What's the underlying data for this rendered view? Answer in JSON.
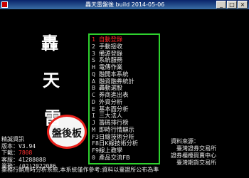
{
  "window": {
    "title": "轟天雷盤後 build 2014-05-06"
  },
  "brand": {
    "chars": [
      "轟",
      "天",
      "雷"
    ]
  },
  "badge": {
    "label": "盤後板"
  },
  "info": {
    "title": "精誠資訊",
    "version": "版本：V3.94",
    "download": "下載：",
    "download_count": "7808",
    "phone": "客服：41288088",
    "service_label": "業務：(02)2022086"
  },
  "menu": {
    "items": [
      {
        "key": "1",
        "label": "自動登錄",
        "active": true
      },
      {
        "key": "2",
        "label": "手動接收"
      },
      {
        "key": "3",
        "label": "備源登錄"
      },
      {
        "key": "S",
        "label": "系統服務"
      },
      {
        "key": "H",
        "label": "電傳作業"
      },
      {
        "key": "Q",
        "label": "融開本系統"
      },
      {
        "key": "A",
        "label": "融資融券統計"
      },
      {
        "key": "B",
        "label": "轟動選股"
      },
      {
        "key": "C",
        "label": "券商進出表"
      },
      {
        "key": "D",
        "label": "外資分析"
      },
      {
        "key": "E",
        "label": "基本面分析"
      },
      {
        "key": "I",
        "label": "三大法人"
      },
      {
        "key": "J",
        "label": "籌碼排行榜"
      },
      {
        "key": "M",
        "label": "即時行情顯示"
      },
      {
        "key": "F3",
        "label": "日線技術分析"
      },
      {
        "key": "F8",
        "label": "日K線技術分析"
      },
      {
        "key": "F9",
        "label": "線上教學"
      },
      {
        "key": "0",
        "label": "產品交流FB"
      }
    ]
  },
  "sources": {
    "title": "資料來源：",
    "lines": [
      "臺灣證券交易所",
      "證券櫃檯買賣中心",
      "臺灣期貨交易所"
    ]
  },
  "footer": {
    "text": "業務行銷用時分析系統,本系統僅作參考:資料以臺證所公布為準"
  }
}
